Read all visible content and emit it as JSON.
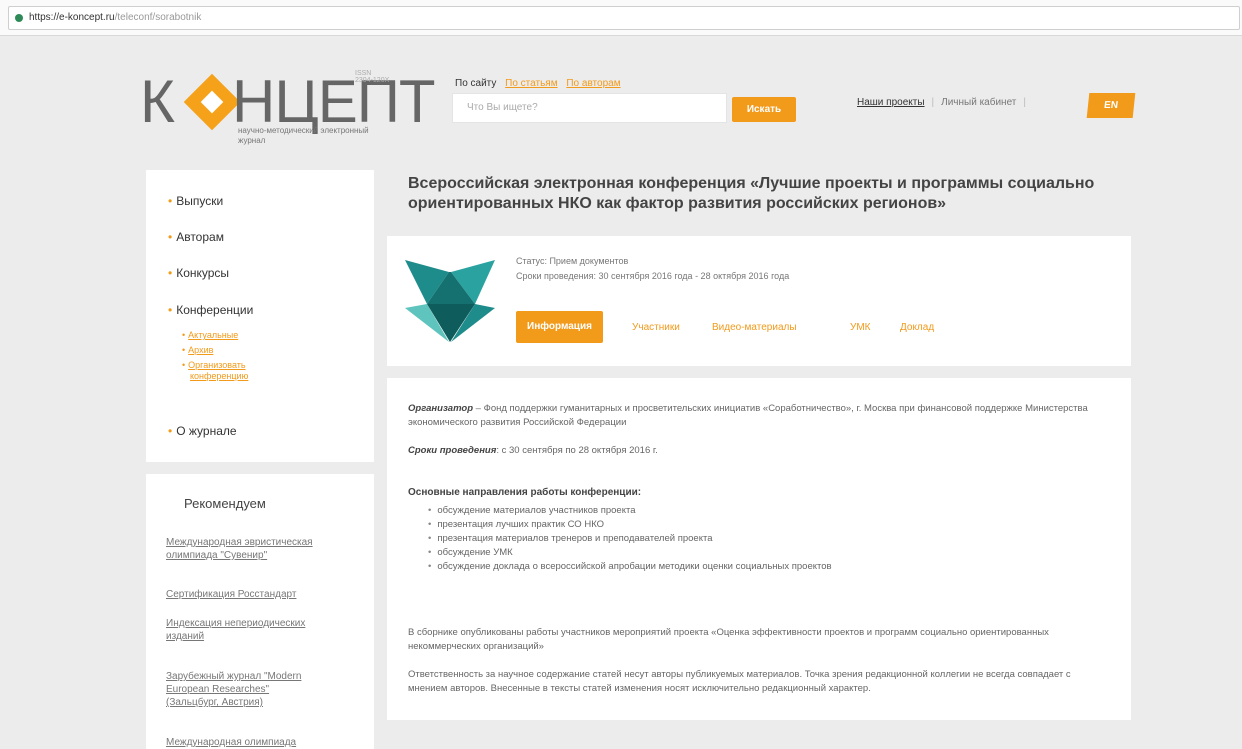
{
  "browser": {
    "url_host": "https://e-koncept.ru",
    "url_path": "/teleconf/sorabotnik"
  },
  "logo": {
    "letter_k": "К",
    "letters_rest": "НЦЕПТ",
    "tag": "ISSN 2304-120X",
    "subtitle": "научно-методический электронный журнал"
  },
  "search": {
    "label_site": "По сайту",
    "link_articles": "По статьям",
    "link_authors": "По авторам",
    "placeholder": "Что Вы ищете?",
    "button": "Искать"
  },
  "top_links": {
    "projects": "Наши проекты",
    "cabinet": "Личный кабинет",
    "lang": "EN"
  },
  "sidebar": {
    "items": [
      {
        "label": "Выпуски"
      },
      {
        "label": "Авторам"
      },
      {
        "label": "Конкурсы"
      },
      {
        "label": "Конференции"
      },
      {
        "label": "О журнале"
      }
    ],
    "sub_items": [
      {
        "label": "Актуальные"
      },
      {
        "label": "Архив"
      },
      {
        "label": "Организовать"
      },
      {
        "label": "конференцию"
      }
    ]
  },
  "recommend": {
    "title": "Рекомендуем",
    "links": [
      {
        "line1": "Международная эвристическая",
        "line2": "олимпиада \"Сувенир\""
      },
      {
        "line1": "Сертификация Росстандарт",
        "line2": ""
      },
      {
        "line1": "Индексация непериодических",
        "line2": "изданий"
      },
      {
        "line1": "Зарубежный журнал \"Modern",
        "line2": "European Researches\"",
        "line3": "(Зальцбург, Австрия)"
      },
      {
        "line1": "Международная олимпиада",
        "line2": ""
      }
    ]
  },
  "page_title": "Всероссийская электронная конференция «Лучшие проекты и программы социально ориентированных НКО как фактор развития российских регионов»",
  "conference": {
    "status": "Статус: Прием документов",
    "dates": "Сроки проведения: 30 сентября 2016 года - 28 октября 2016 года",
    "tabs": [
      {
        "label": "Информация",
        "active": true
      },
      {
        "label": "Участники"
      },
      {
        "label": "Видео-материалы"
      },
      {
        "label": "УМК"
      },
      {
        "label": "Доклад"
      }
    ],
    "logo_colors": [
      "#1f8c8c",
      "#2aa3a0",
      "#157070",
      "#5fc4bd",
      "#0f5c5c"
    ]
  },
  "content": {
    "organizer_label": "Организатор",
    "organizer_text": " – Фонд поддержки гуманитарных и просветительских инициатив «Соработничество», г. Москва при финансовой поддержке Министерства экономического развития Российской Федерации",
    "dates_label": "Сроки проведения",
    "dates_text": ": с 30 сентября по 28 октября 2016 г.",
    "directions_title": "Основные направления работы конференции:",
    "directions": [
      "обсуждение материалов участников проекта",
      "презентация лучших практик СО НКО",
      "презентация материалов тренеров и преподавателей проекта",
      "обсуждение УМК",
      "обсуждение доклада о всероссийской апробации методики оценки социальных проектов"
    ],
    "para1": "В сборнике опубликованы работы участников мероприятий проекта «Оценка эффективности проектов и программ социально ориентированных некоммерческих организаций»",
    "para2": "Ответственность за научное содержание статей несут авторы публикуемых материалов. Точка зрения редакционной коллегии не всегда совпадает с мнением авторов. Внесенные в тексты статей изменения носят исключительно редакционный характер."
  },
  "colors": {
    "accent": "#f29a1a",
    "background": "#ececec"
  }
}
